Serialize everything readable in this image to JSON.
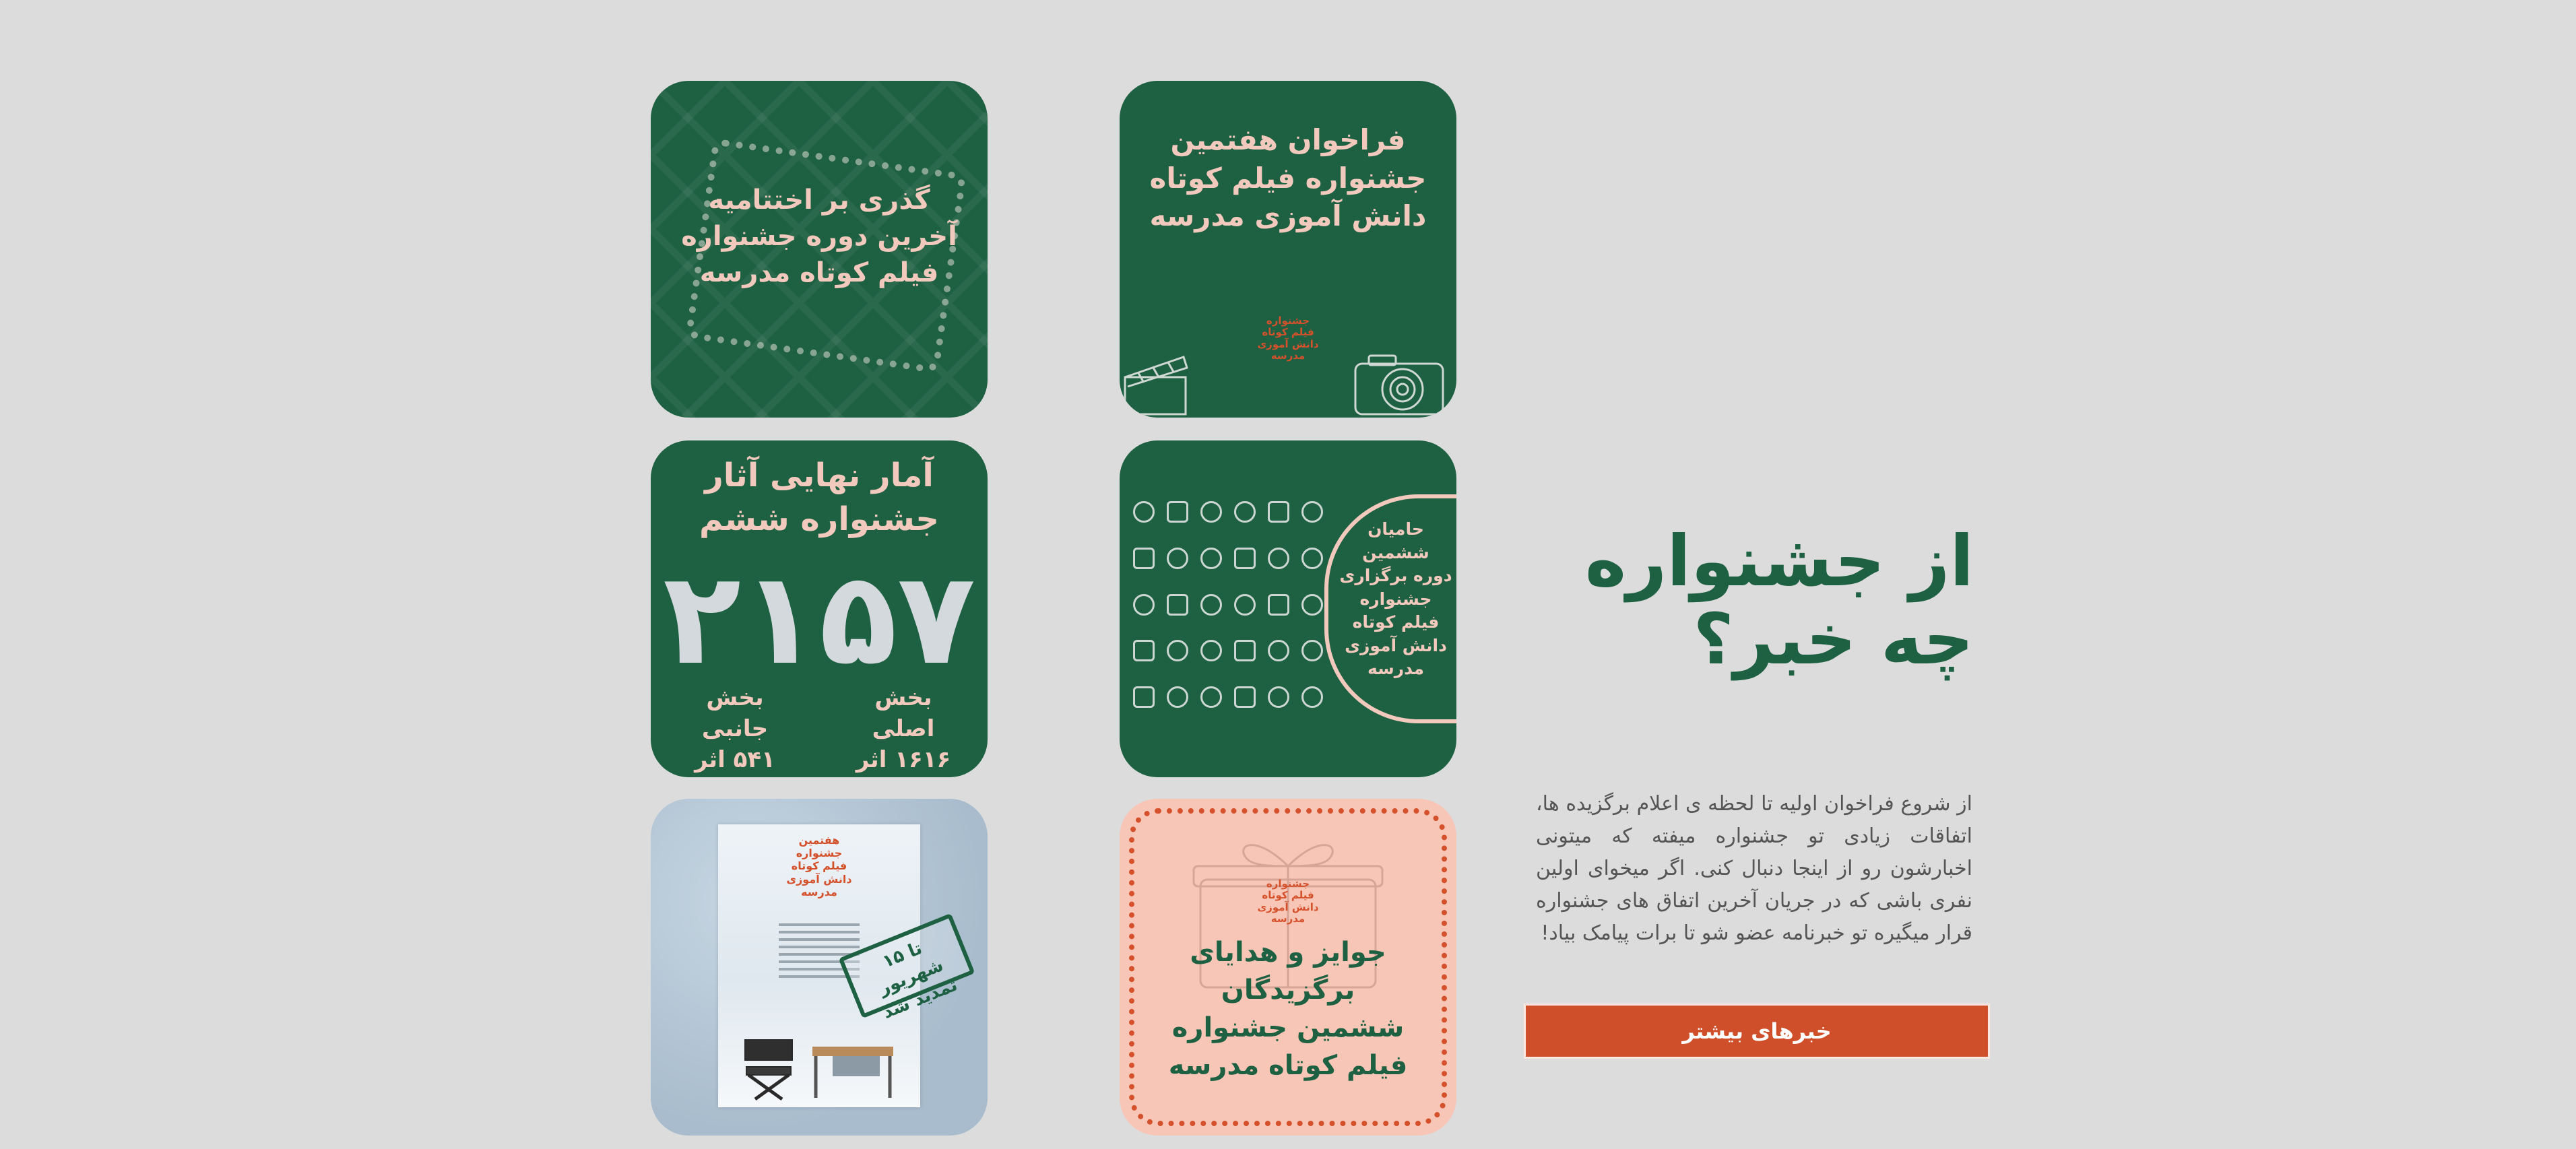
{
  "news_section": {
    "heading_lines": [
      "از جشنواره",
      "چه خبر؟"
    ],
    "description": "از شروع فراخوان اولیه تا لحظه ی اعلام برگزیده ها، اتفاقات زیادی تو جشنواره میفته که میتونی اخبارشون رو از اینجا دنبال کنی. اگر میخوای اولین نفری باشی که در جریان آخرین اتفاق های جشنواره قرار میگیره تو خبرنامه عضو شو تا برات پیامک بیاد!",
    "more_button": "خبرهای بیشتر"
  },
  "tiles": [
    {
      "name": "closing-ceremony",
      "lines": [
        "گذری بر اختتامیه",
        "آخرین دوره جشنواره",
        "فیلم کوتاه مدرسه"
      ]
    },
    {
      "name": "call-for-entries",
      "lines": [
        "فراخوان هفتمین",
        "جشنواره فیلم کوتاه",
        "دانش آموزی مدرسه"
      ],
      "logo_lines": [
        "جشنواره",
        "فیلم کوتاه",
        "دانش آموزی",
        "مدرسه"
      ]
    },
    {
      "name": "final-stats",
      "lines": [
        "آمار نهایی آثار",
        "جشنواره ششم"
      ],
      "big_number": "۲۱۵۷",
      "stats": [
        {
          "lines": [
            "بخش جانبی",
            "۵۴۱ اثر"
          ]
        },
        {
          "lines": [
            "بخش اصلی",
            "۱۶۱۶ اثر"
          ]
        }
      ]
    },
    {
      "name": "sponsors",
      "lines": [
        "حامیان",
        "ششمین",
        "دوره برگزاری",
        "جشنواره",
        "فیلم کوتاه",
        "دانش آموزی",
        "مدرسه"
      ]
    },
    {
      "name": "deadline-extended",
      "poster_lines": [
        "هفتمین",
        "جشنواره",
        "فیلم کوتاه",
        "دانش آموزی",
        "مدرسه"
      ],
      "stamp_lines": [
        "تا ۱۵ شهریور",
        "تمدید شد"
      ]
    },
    {
      "name": "awards",
      "lines": [
        "جوایز و هدایای",
        "برگزیدگان",
        "ششمین جشنواره",
        "فیلم کوتاه مدرسه"
      ],
      "logo_lines": [
        "جشنواره",
        "فیلم کوتاه",
        "دانش آموزی",
        "مدرسه"
      ]
    }
  ],
  "colors": {
    "background": "#dcdcdc",
    "green": "#1e6042",
    "orange": "#cf4f2a",
    "pink": "#f8c6b6"
  }
}
